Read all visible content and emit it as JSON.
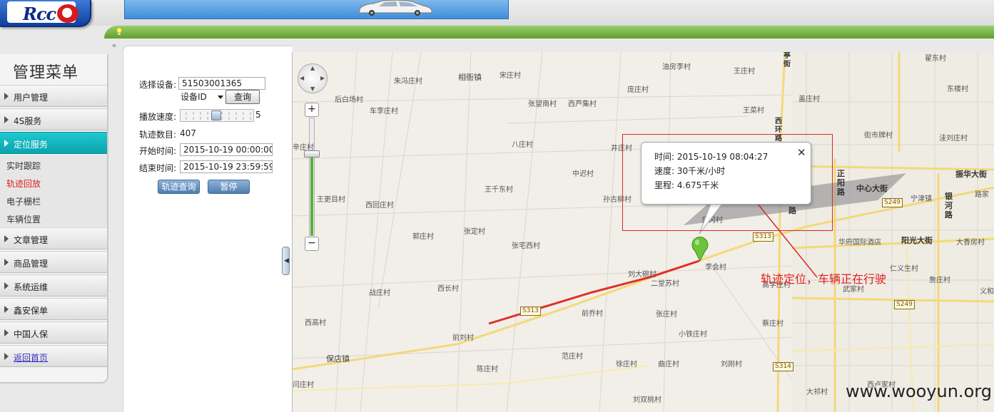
{
  "header": {
    "logo_text": "Rcc"
  },
  "sidebar": {
    "title": "管理菜单",
    "items": [
      {
        "label": "用户管理"
      },
      {
        "label": "4S服务"
      },
      {
        "label": "定位服务"
      },
      {
        "label": "文章管理"
      },
      {
        "label": "商品管理"
      },
      {
        "label": "系统运维"
      },
      {
        "label": "鑫安保单"
      },
      {
        "label": "中国人保"
      },
      {
        "label": "返回首页"
      }
    ],
    "subitems": [
      {
        "label": "实时跟踪"
      },
      {
        "label": "轨迹回放"
      },
      {
        "label": "电子栅栏"
      },
      {
        "label": "车辆位置"
      }
    ]
  },
  "panel": {
    "device_label": "选择设备:",
    "device_value": "51503001365",
    "device_type": "设备ID",
    "query_label": "查询",
    "speed_label": "播放速度:",
    "speed_value": "5",
    "speed_level": 0.5,
    "count_label": "轨迹数目:",
    "count_value": "407",
    "start_label": "开始时间:",
    "start_value": "2015-10-19 00:00:00",
    "end_label": "结束时间:",
    "end_value": "2015-10-19 23:59:59",
    "track_query_label": "轨迹查询",
    "pause_label": "暂停"
  },
  "map": {
    "zoom_in": "+",
    "zoom_out": "−",
    "info": {
      "time_label": "时间:",
      "time_value": "2015-10-19 08:04:27",
      "speed_label": "速度:",
      "speed_value": "30千米/小时",
      "mileage_label": "里程:",
      "mileage_value": "4.675千米",
      "close": "✕"
    },
    "places": {
      "p1": "朱冯庄村",
      "p2": "相衙镇",
      "p3": "宋庄村",
      "p4": "油房李村",
      "p5": "王庄村",
      "p6": "翟东村",
      "p7": "后白场村",
      "p8": "车李庄村",
      "p9": "张望南村",
      "p10": "西芦集村",
      "p11": "庞庄村",
      "p12": "盖庄村",
      "p13": "东楼村",
      "p14": "王菜村",
      "p15": "街市牌村",
      "p16": "洼刘庄村",
      "p17": "辛庄村",
      "p18": "八庄村",
      "p19": "井庄村",
      "p20": "中迟村",
      "p21": "王千东村",
      "p22": "孙古柳村",
      "p23": "王更目村",
      "p24": "西回庄村",
      "p25": "皇冈村",
      "p26": "郭庄村",
      "p27": "张定村",
      "p28": "张宅西村",
      "p29": "李会村",
      "p30": "刘大碗村",
      "p31": "二堂苏村",
      "p32": "战庄村",
      "p33": "西长村",
      "p34": "西高村",
      "p35": "前乔村",
      "p36": "张庄村",
      "p37": "小铁庄村",
      "p38": "前刘村",
      "p39": "保店镇",
      "p40": "范庄村",
      "p41": "陈庄村",
      "p42": "徐庄村",
      "p43": "曲庄村",
      "p44": "刘刚村",
      "p45": "蔡庄村",
      "p46": "闫庄村",
      "p47": "刘双桃村",
      "p48": "大祁村",
      "p49": "西卢家村",
      "p50": "高学庄村",
      "p51": "武家村",
      "p52": "仁义生村",
      "p53": "詹庄村",
      "p54": "华府国际酒店",
      "p55": "中心大街",
      "p56": "阳光大街",
      "p57": "宁津镇",
      "p58": "大香房村",
      "p59": "振华大街",
      "p60": "路家",
      "p61": "义和"
    },
    "roads": {
      "r1": "亭街",
      "r2": "西环路",
      "r3": "正阳路",
      "r4": "银河路",
      "r5": "路"
    },
    "shields": {
      "s1": "S313",
      "s2": "S313",
      "s3": "S249",
      "s4": "S249",
      "s5": "S314"
    }
  },
  "annotation": {
    "text": "轨迹定位，车辆正在行驶"
  },
  "watermark": "www.wooyun.org"
}
